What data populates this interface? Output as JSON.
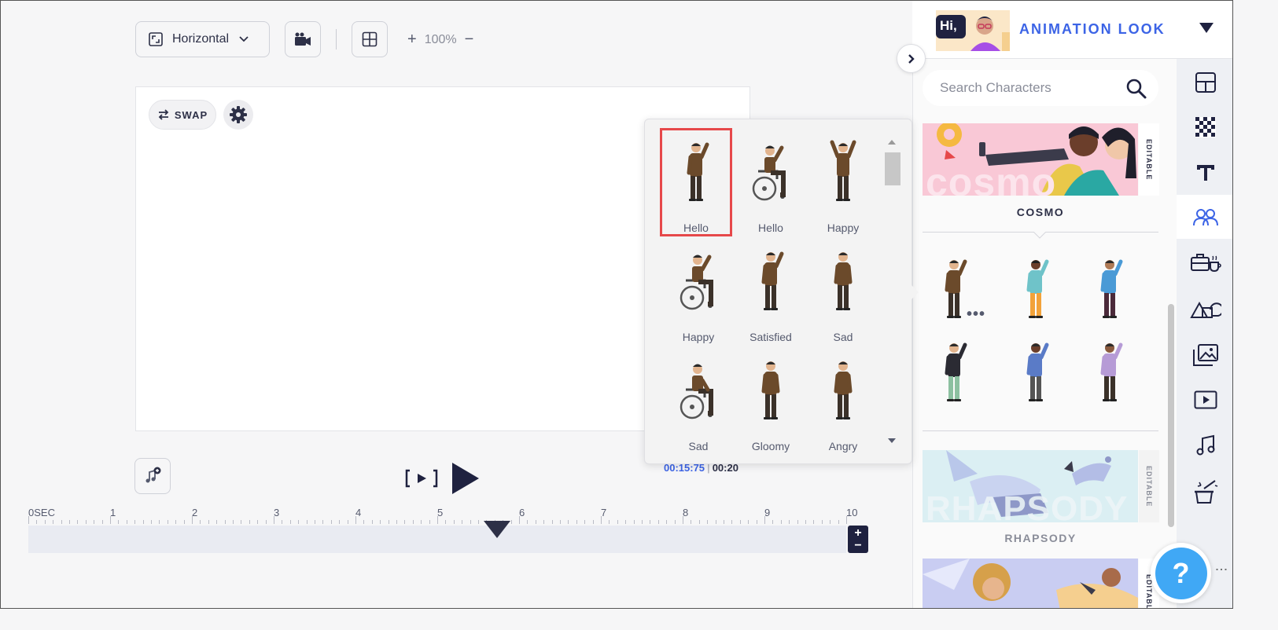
{
  "toolbar": {
    "orientation_label": "Horizontal",
    "zoom_level": "100%",
    "zoom_in": "+",
    "zoom_out": "−"
  },
  "canvas": {
    "swap_label": "SWAP"
  },
  "playback": {
    "current_time": "00:15:75",
    "separator": "|",
    "total_time": "00:20"
  },
  "timeline": {
    "labels": [
      "0SEC",
      "1",
      "2",
      "3",
      "4",
      "5",
      "6",
      "7",
      "8",
      "9",
      "10"
    ],
    "zoom_plus": "+",
    "zoom_minus": "−"
  },
  "pose_popup": {
    "poses": [
      {
        "label": "Hello",
        "selected": true
      },
      {
        "label": "Hello",
        "selected": false
      },
      {
        "label": "Happy",
        "selected": false
      },
      {
        "label": "Happy",
        "selected": false
      },
      {
        "label": "Satisfied",
        "selected": false
      },
      {
        "label": "Sad",
        "selected": false
      },
      {
        "label": "Sad",
        "selected": false
      },
      {
        "label": "Gloomy",
        "selected": false
      },
      {
        "label": "Angry",
        "selected": false
      }
    ]
  },
  "panel": {
    "look_title": "ANIMATION LOOK",
    "look_thumb_text": "Hi,",
    "search_placeholder": "Search Characters",
    "themes": [
      {
        "name": "COSMO",
        "banner_text": "cosmo",
        "editable": "EDITABLE"
      },
      {
        "name": "RHAPSODY",
        "banner_text": "RHAPSODY",
        "editable": "EDITABLE"
      },
      {
        "name": "",
        "banner_text": "",
        "editable": "EDITABLE"
      }
    ],
    "more_dots": "•••"
  },
  "help": {
    "label": "?",
    "menu": "⋮"
  },
  "colors": {
    "accent": "#3c64e6",
    "dark": "#1f2240",
    "selection": "#e6484a",
    "help": "#40a8f5"
  }
}
